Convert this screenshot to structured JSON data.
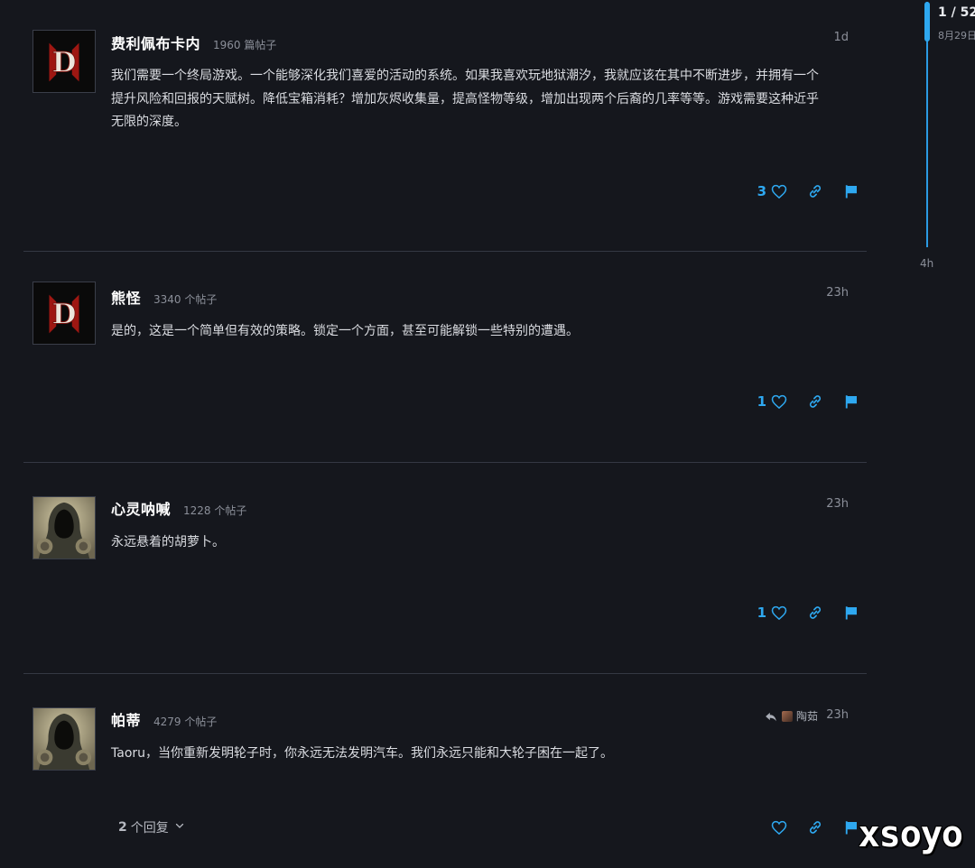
{
  "posts": [
    {
      "username": "费利佩布卡内",
      "post_count": "1960 篇帖子",
      "time": "1d",
      "avatar": "diablo-iv-logo",
      "body_lines": [
        "我们需要一个终局游戏。一个能够深化我们喜爱的活动的系统。如果我喜欢玩地狱潮汐，我就应该在其中不断进步，并拥有一个",
        "提升风险和回报的天赋树。降低宝箱消耗？增加灰烬收集量，提高怪物等级，增加出现两个后裔的几率等等。游戏需要这种近乎",
        "无限的深度。"
      ],
      "likes": "3"
    },
    {
      "username": "熊怪",
      "post_count": "3340 个帖子",
      "time": "23h",
      "avatar": "diablo-iv-logo",
      "body_lines": [
        "是的，这是一个简单但有效的策略。锁定一个方面，甚至可能解锁一些特别的遭遇。"
      ],
      "likes": "1"
    },
    {
      "username": "心灵呐喊",
      "post_count": "1228 个帖子",
      "time": "23h",
      "avatar": "hooded-wanderer",
      "body_lines": [
        "永远悬着的胡萝卜。"
      ],
      "likes": "1"
    },
    {
      "username": "帕蒂",
      "post_count": "4279 个帖子",
      "time": "23h",
      "avatar": "hooded-wanderer",
      "reply_to": "陶茹",
      "body_lines": [
        "Taoru，当你重新发明轮子时，你永远无法发明汽车。我们永远只能和大轮子困在一起了。"
      ],
      "likes": "",
      "replies_count": "2",
      "replies_label": "个回复"
    }
  ],
  "timeline": {
    "position": "1 / 52",
    "date": "8月29日",
    "end_label": "4h"
  },
  "watermark": "xsoyo",
  "colors": {
    "background": "#15171d",
    "accent": "#2ea8f0",
    "divider": "#343843"
  }
}
